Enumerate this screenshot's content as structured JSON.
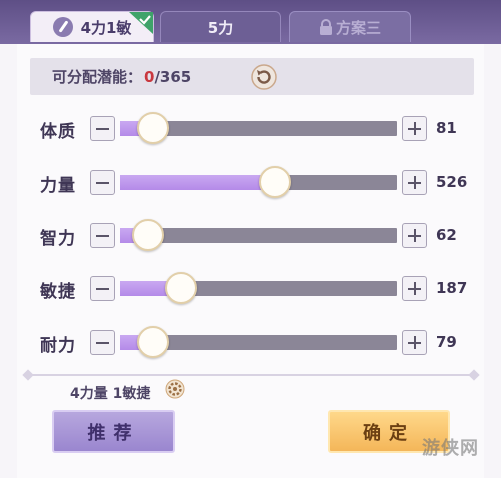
{
  "tabs": [
    {
      "label": "4力1敏",
      "active": true
    },
    {
      "label": "5力",
      "active": false
    },
    {
      "label": "方案三",
      "locked": true
    }
  ],
  "points": {
    "label": "可分配潜能：",
    "used": "0",
    "total": "/365"
  },
  "stats": [
    {
      "label": "体质",
      "value": "81",
      "fill": 0.12
    },
    {
      "label": "力量",
      "value": "526",
      "fill": 0.56
    },
    {
      "label": "智力",
      "value": "62",
      "fill": 0.1
    },
    {
      "label": "敏捷",
      "value": "187",
      "fill": 0.22
    },
    {
      "label": "耐力",
      "value": "79",
      "fill": 0.12
    }
  ],
  "plan_summary": "4力量 1敏捷",
  "buttons": {
    "recommend": "推荐",
    "confirm": "确定"
  },
  "watermark": "游侠网",
  "colors": {
    "fill": "#b48ae8",
    "track": "#8b8697",
    "used": "#c9383f",
    "confirm": "#f4b659",
    "recommend": "#9a86cf"
  }
}
